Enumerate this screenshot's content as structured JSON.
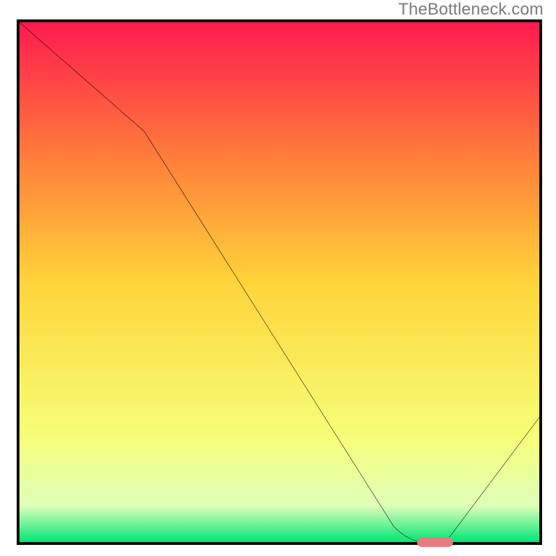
{
  "watermark": "TheBottleneck.com",
  "chart_data": {
    "type": "line",
    "title": "",
    "xlabel": "",
    "ylabel": "",
    "xlim": [
      0,
      100
    ],
    "ylim": [
      0,
      100
    ],
    "grid": false,
    "legend": false,
    "annotations": [],
    "background": {
      "type": "vertical-gradient",
      "stops": [
        {
          "pos": 0.0,
          "color": "#ff1a4f"
        },
        {
          "pos": 0.25,
          "color": "#ff7a3a"
        },
        {
          "pos": 0.5,
          "color": "#ffd43a"
        },
        {
          "pos": 0.8,
          "color": "#f6ff7a"
        },
        {
          "pos": 0.93,
          "color": "#dfffb9"
        },
        {
          "pos": 1.0,
          "color": "#00e676"
        }
      ]
    },
    "series": [
      {
        "name": "bottleneck-curve",
        "color": "#000000",
        "x": [
          0,
          24,
          72,
          78,
          82,
          100
        ],
        "y": [
          100,
          79,
          3,
          0,
          0,
          24
        ]
      }
    ],
    "curve_segments": [
      {
        "type": "line",
        "from": [
          0,
          100
        ],
        "to": [
          24,
          79
        ]
      },
      {
        "type": "line",
        "from": [
          24,
          79
        ],
        "to": [
          72,
          3
        ]
      },
      {
        "type": "curve",
        "from": [
          72,
          3
        ],
        "ctrl": [
          75,
          0
        ],
        "to": [
          78,
          0
        ]
      },
      {
        "type": "line",
        "from": [
          78,
          0
        ],
        "to": [
          82,
          0
        ]
      },
      {
        "type": "line",
        "from": [
          82,
          0
        ],
        "to": [
          100,
          24
        ]
      }
    ],
    "marker": {
      "name": "optimum-pill",
      "color": "#e77b82",
      "x": 80,
      "y": 0
    }
  }
}
